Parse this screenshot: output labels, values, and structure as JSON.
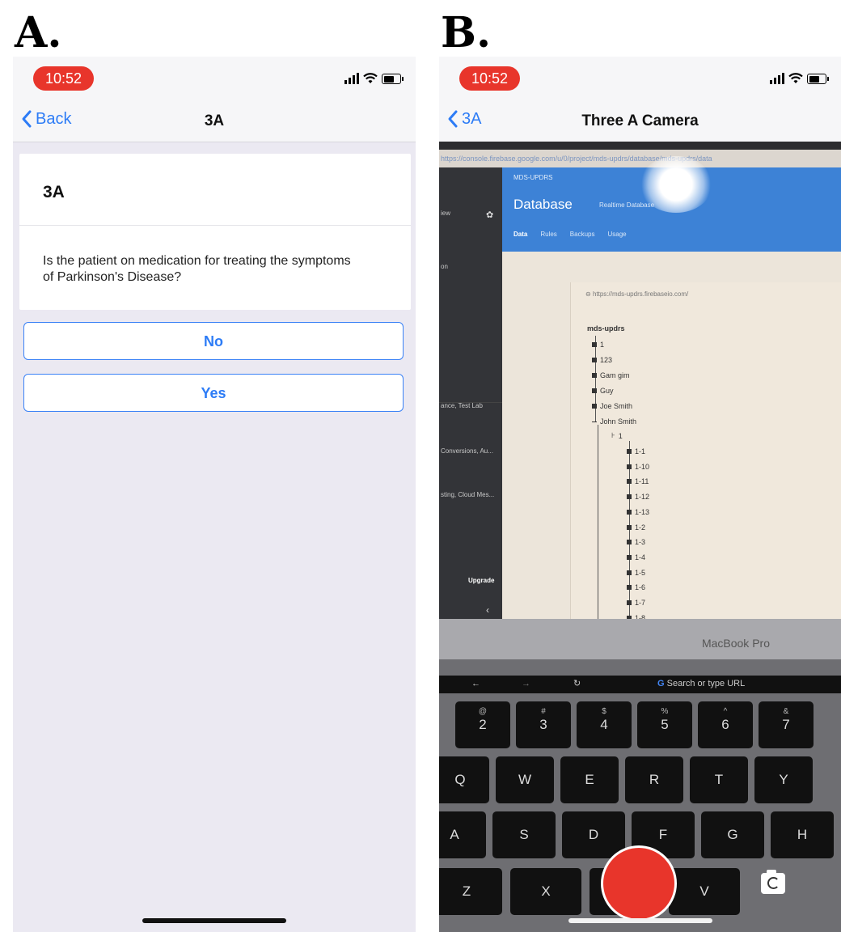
{
  "panel_labels": {
    "a": "A.",
    "b": "B."
  },
  "phone_a": {
    "status_time": "10:52",
    "back_label": "Back",
    "nav_title": "3A",
    "card_title": "3A",
    "question": "Is the patient on medication for treating the symptoms of Parkinson's Disease?",
    "answers": [
      "No",
      "Yes"
    ]
  },
  "phone_b": {
    "status_time": "10:52",
    "back_label": "3A",
    "nav_title": "Three A Camera",
    "camera": {
      "url": "https://console.firebase.google.com/u/0/project/mds-updrs/database/mds-updrs/data",
      "project": "MDS-UPDRS",
      "section": "Database",
      "db_type": "Realtime Database",
      "tabs": [
        "Data",
        "Rules",
        "Backups",
        "Usage"
      ],
      "db_url": "https://mds-updrs.firebaseio.com/",
      "root": "mds-updrs",
      "top_nodes": [
        "1",
        "123",
        "Gam gim",
        "Guy",
        "Joe Smith",
        "John Smith"
      ],
      "sub_node": "1",
      "leaf_nodes": [
        "1-1",
        "1-10",
        "1-11",
        "1-12",
        "1-13",
        "1-2",
        "1-3",
        "1-4",
        "1-5",
        "1-6",
        "1-7",
        "1-8"
      ],
      "sidebar_items": [
        "iew",
        "on",
        "ance, Test Lab",
        "Conversions, Au...",
        "sting, Cloud Mes...",
        "Upgrade"
      ],
      "laptop_label": "MacBook Pro",
      "touchbar_search": "Search or type URL",
      "number_keys": [
        [
          "@",
          "2"
        ],
        [
          "#",
          "3"
        ],
        [
          "$",
          "4"
        ],
        [
          "%",
          "5"
        ],
        [
          "^",
          "6"
        ],
        [
          "&",
          "7"
        ]
      ],
      "letter_row1": [
        "Q",
        "W",
        "E",
        "R",
        "T",
        "Y"
      ],
      "letter_row2": [
        "A",
        "S",
        "D",
        "F",
        "G",
        "H"
      ],
      "letter_row3": [
        "Z",
        "X",
        "C",
        "V"
      ]
    }
  },
  "colors": {
    "accent": "#2d7cf6",
    "status_pill": "#e8352b",
    "shutter": "#e8352b"
  }
}
